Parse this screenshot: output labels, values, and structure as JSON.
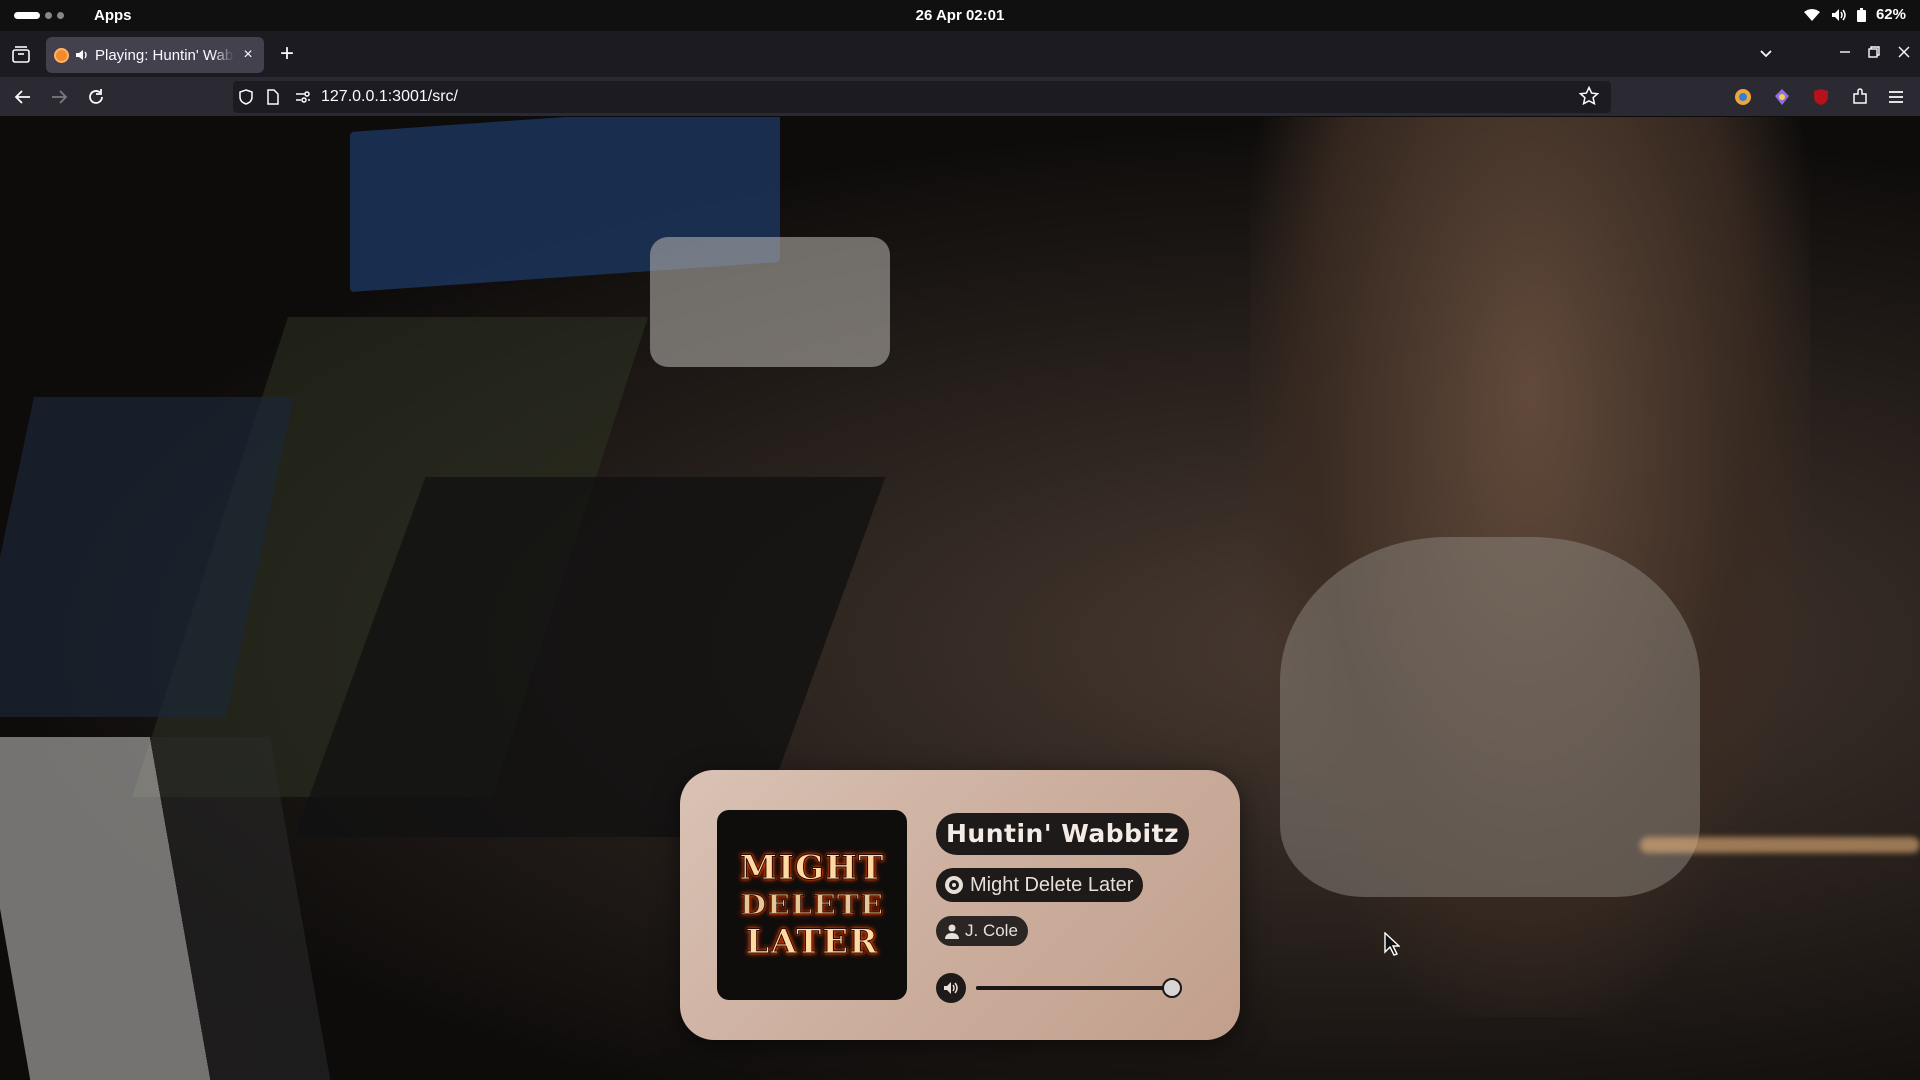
{
  "system_bar": {
    "apps_label": "Apps",
    "clock": "26 Apr  02:01",
    "battery": "62%"
  },
  "browser": {
    "tab": {
      "title": "Playing: Huntin' Wabbitz",
      "close_glyph": "×",
      "favicon_color": "#f28b2c"
    },
    "new_tab_glyph": "+",
    "url": "127.0.0.1:3001/src/",
    "icons": [
      "tab-list-icon",
      "back-icon",
      "forward-icon",
      "reload-icon",
      "shield-icon",
      "page-icon",
      "permissions-icon",
      "star-icon",
      "extension-icons",
      "menu-icon"
    ]
  },
  "player": {
    "song_title": "Huntin' Wabbitz",
    "album": "Might Delete Later",
    "artist": "J. Cole",
    "cover_text": [
      "MIGHT",
      "DELETE",
      "LATER"
    ],
    "volume": 1.0,
    "card_color": "#cdb0a0",
    "pill_color": "#1d1a19"
  }
}
